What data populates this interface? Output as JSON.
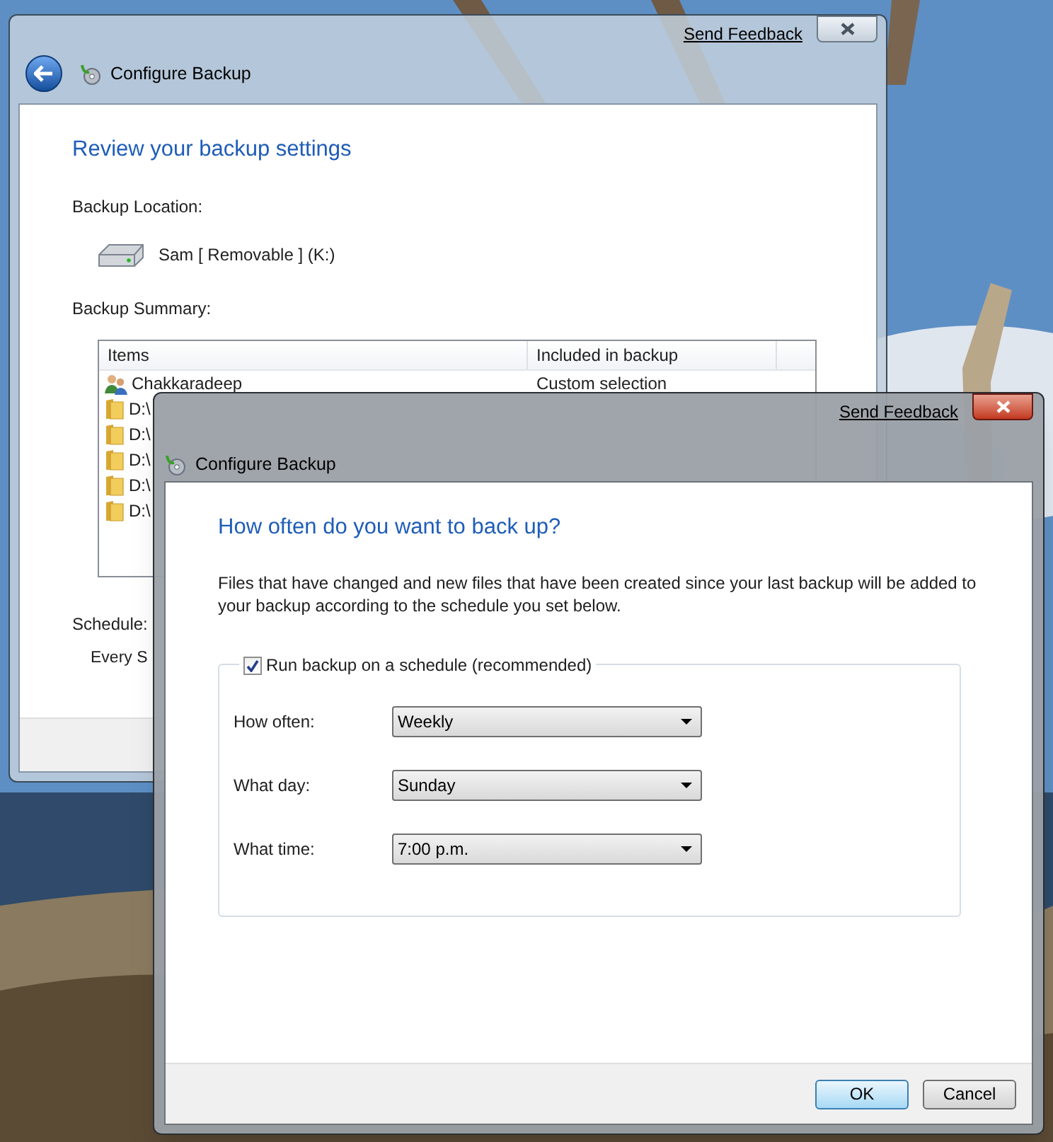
{
  "back_window": {
    "active": false,
    "send_feedback": "Send Feedback",
    "title": "Configure Backup",
    "heading": "Review your backup settings",
    "location_label": "Backup Location:",
    "location": "Sam [ Removable ] (K:)",
    "summary_label": "Backup Summary:",
    "table": {
      "columns": [
        "Items",
        "Included in backup"
      ],
      "rows": [
        {
          "kind": "user",
          "item": "Chakkaradeep",
          "included": "Custom selection"
        },
        {
          "kind": "folder",
          "item": "D:\\"
        },
        {
          "kind": "folder",
          "item": "D:\\"
        },
        {
          "kind": "folder",
          "item": "D:\\"
        },
        {
          "kind": "folder",
          "item": "D:\\"
        },
        {
          "kind": "folder",
          "item": "D:\\"
        }
      ]
    },
    "schedule_label": "Schedule:",
    "schedule_value": "Every S"
  },
  "dialog": {
    "active": true,
    "send_feedback": "Send Feedback",
    "title": "Configure Backup",
    "heading": "How often do you want to back up?",
    "description": "Files that have changed and new files that have been created since your last backup will be added to your backup according to the schedule you set below.",
    "schedule_checkbox": {
      "label": "Run backup on a schedule (recommended)",
      "checked": true
    },
    "fields": [
      {
        "label": "How often:",
        "value": "Weekly"
      },
      {
        "label": "What day:",
        "value": "Sunday"
      },
      {
        "label": "What time:",
        "value": "7:00 p.m."
      }
    ],
    "buttons": [
      {
        "label": "OK",
        "default": true
      },
      {
        "label": "Cancel",
        "default": false
      }
    ]
  }
}
